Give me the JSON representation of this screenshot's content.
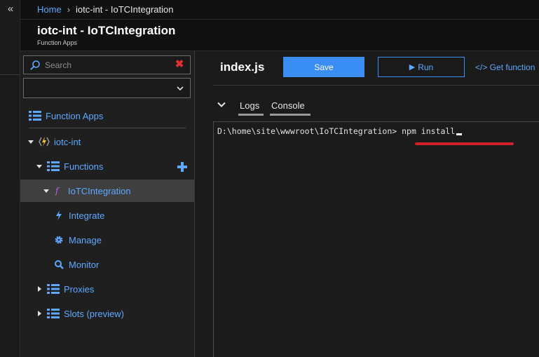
{
  "breadcrumb": {
    "home": "Home",
    "separator": "›",
    "current": "iotc-int - IoTCIntegration"
  },
  "header": {
    "title": "iotc-int - IoTCIntegration",
    "subtitle": "Function Apps"
  },
  "sidebar": {
    "search_placeholder": "Search",
    "subscription_value": "",
    "items": [
      {
        "label": "Function Apps",
        "icon": "list-icon"
      },
      {
        "label": "iotc-int",
        "icon": "bolt-icon"
      },
      {
        "label": "Functions",
        "icon": "list-icon"
      },
      {
        "label": "IoTCIntegration",
        "icon": "function-icon"
      },
      {
        "label": "Integrate",
        "icon": "bolt-icon"
      },
      {
        "label": "Manage",
        "icon": "gear-icon"
      },
      {
        "label": "Monitor",
        "icon": "search-icon"
      },
      {
        "label": "Proxies",
        "icon": "list-icon"
      },
      {
        "label": "Slots (preview)",
        "icon": "list-icon"
      }
    ]
  },
  "editor": {
    "file_name": "index.js",
    "save_label": "Save",
    "run_label": "Run",
    "get_function_url_label": "</> Get function",
    "tabs": [
      "Logs",
      "Console"
    ],
    "console_prompt": "D:\\home\\site\\wwwroot\\IoTCIntegration>",
    "console_input": " npm install"
  },
  "colors": {
    "accent": "#3a8df5",
    "link": "#5ea8ff",
    "highlight_mark": "#d0202a",
    "selected_row": "#3f3f3f"
  }
}
